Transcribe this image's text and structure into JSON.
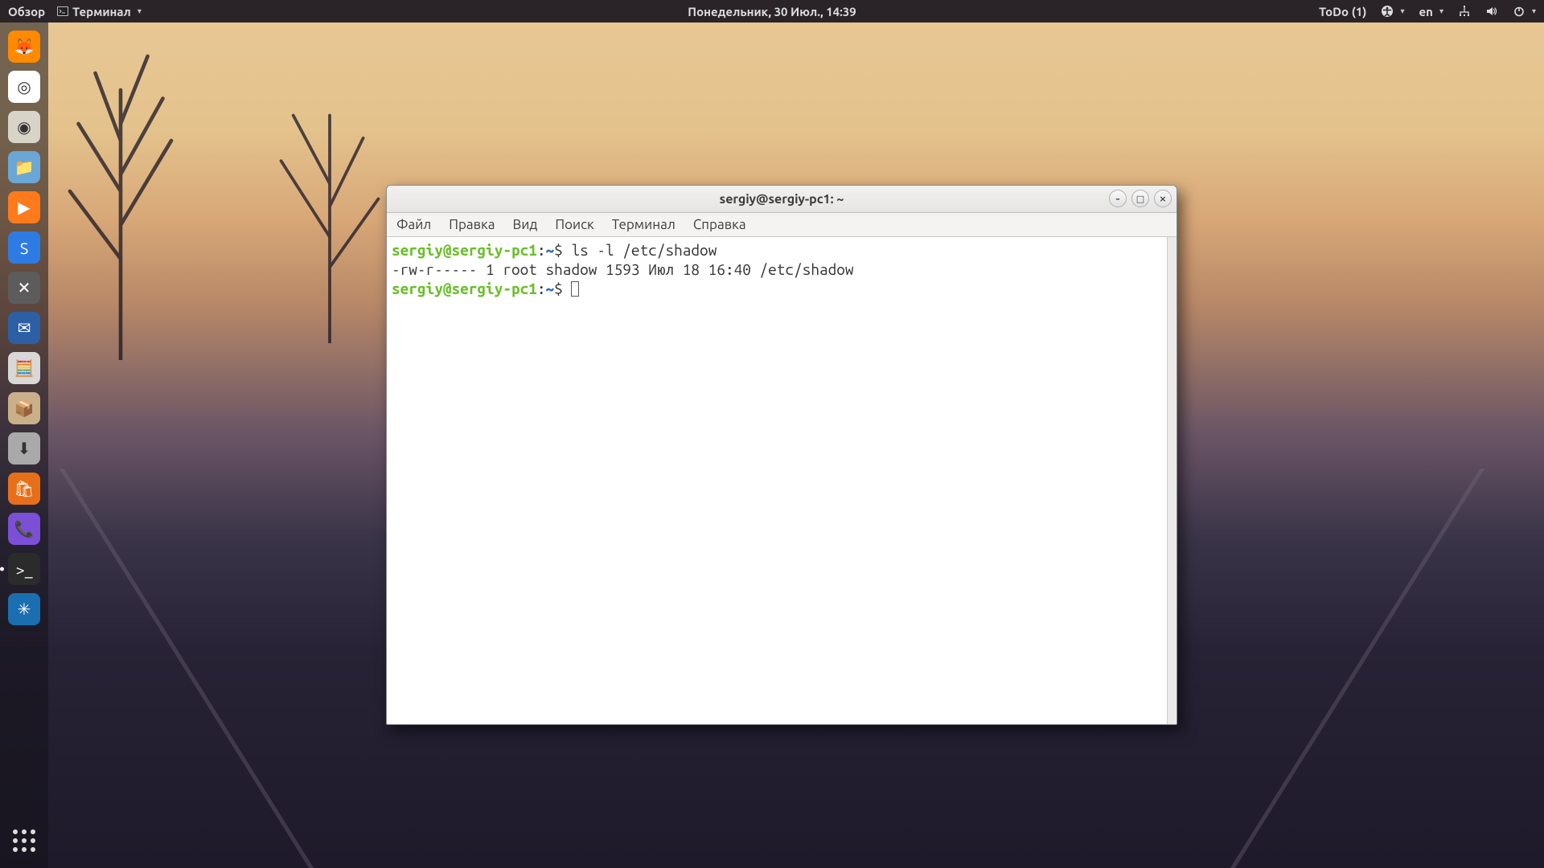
{
  "topbar": {
    "activities": "Обзор",
    "app_indicator": "Терминал",
    "datetime": "Понедельник, 30 Июл., 14:39",
    "todo": "ToDo (1)",
    "keyboard": "en"
  },
  "dock": {
    "items": [
      {
        "name": "firefox",
        "bg": "#ff8a00",
        "glyph": "🦊"
      },
      {
        "name": "chrome",
        "bg": "#ffffff",
        "glyph": "◎"
      },
      {
        "name": "rhythmbox",
        "bg": "#d9d4c8",
        "glyph": "◉"
      },
      {
        "name": "files",
        "bg": "#6aa6d6",
        "glyph": "📁"
      },
      {
        "name": "vlc",
        "bg": "#ff7a1a",
        "glyph": "▶"
      },
      {
        "name": "simplenote",
        "bg": "#2f7be4",
        "glyph": "S"
      },
      {
        "name": "settings",
        "bg": "#5c5c5c",
        "glyph": "✕"
      },
      {
        "name": "thunderbird",
        "bg": "#2d5fa4",
        "glyph": "✉"
      },
      {
        "name": "calculator",
        "bg": "#d8d8d8",
        "glyph": "🧮"
      },
      {
        "name": "archive",
        "bg": "#c9b08a",
        "glyph": "📦"
      },
      {
        "name": "transmission",
        "bg": "#a9a9a9",
        "glyph": "⬇"
      },
      {
        "name": "software",
        "bg": "#e86f1a",
        "glyph": "🛍"
      },
      {
        "name": "viber",
        "bg": "#7b4fd6",
        "glyph": "📞"
      },
      {
        "name": "terminal",
        "bg": "#2b2b2b",
        "glyph": ">_",
        "active": true
      },
      {
        "name": "app",
        "bg": "#1b6fb0",
        "glyph": "✳"
      }
    ]
  },
  "terminal": {
    "title": "sergiy@sergiy-pc1: ~",
    "menu": [
      "Файл",
      "Правка",
      "Вид",
      "Поиск",
      "Терминал",
      "Справка"
    ],
    "prompt_user_host": "sergiy@sergiy-pc1",
    "prompt_sep": ":",
    "prompt_path": "~",
    "prompt_sigil": "$",
    "lines": [
      {
        "cmd": "ls -l /etc/shadow"
      },
      {
        "out": "-rw-r----- 1 root shadow 1593 Июл 18 16:40 /etc/shadow"
      }
    ]
  }
}
